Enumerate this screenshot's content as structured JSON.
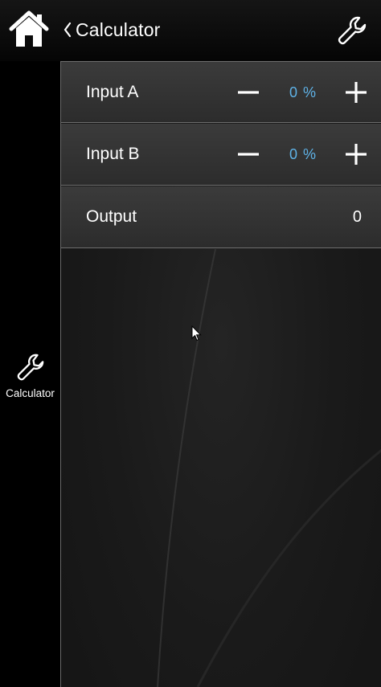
{
  "header": {
    "home_icon": "home-icon",
    "back_icon": "chevron-left-icon",
    "title": "Calculator",
    "settings_icon": "wrench-icon"
  },
  "sidebar": {
    "items": [
      {
        "label": "Calculator",
        "icon": "wrench-icon"
      }
    ]
  },
  "rows": [
    {
      "label": "Input A",
      "value": "0 %",
      "minus_icon": "minus-icon",
      "plus_icon": "plus-icon"
    },
    {
      "label": "Input B",
      "value": "0 %",
      "minus_icon": "minus-icon",
      "plus_icon": "plus-icon"
    },
    {
      "label": "Output",
      "value": "0"
    }
  ],
  "colors": {
    "accent_value": "#5fb3e8",
    "row_background": "#333333",
    "row_divider": "#6d6d6d",
    "background": "#000000"
  }
}
